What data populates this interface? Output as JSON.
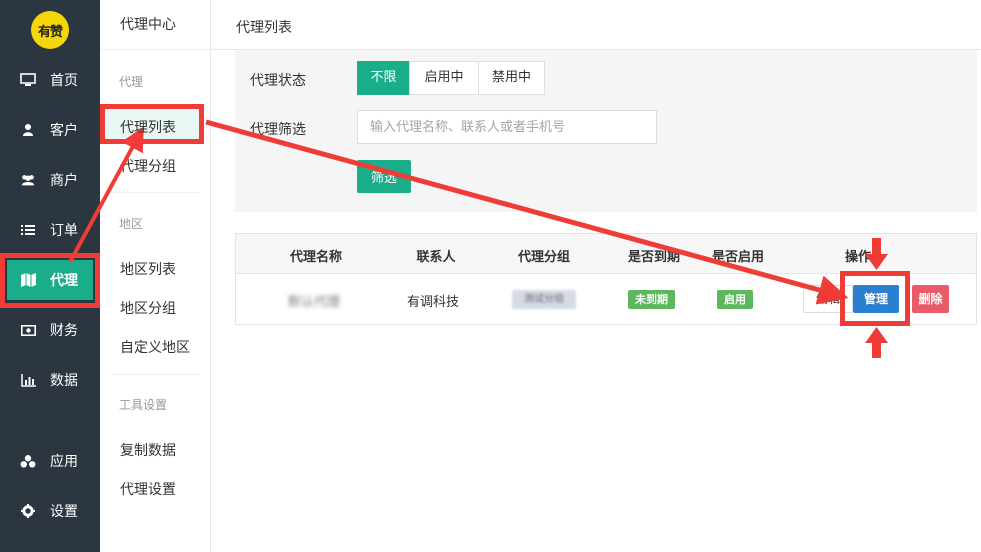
{
  "logo": {
    "text": "有赞"
  },
  "nav": {
    "items": [
      {
        "label": "首页",
        "icon": "monitor-icon"
      },
      {
        "label": "客户",
        "icon": "user-icon"
      },
      {
        "label": "商户",
        "icon": "users-icon"
      },
      {
        "label": "订单",
        "icon": "list-icon"
      },
      {
        "label": "代理",
        "icon": "map-icon",
        "active": true
      },
      {
        "label": "财务",
        "icon": "money-icon"
      },
      {
        "label": "数据",
        "icon": "bar-chart-icon"
      },
      {
        "label": "应用",
        "icon": "apps-icon"
      },
      {
        "label": "设置",
        "icon": "gear-icon"
      }
    ]
  },
  "submenu": {
    "title": "代理中心",
    "group1": "代理",
    "item_list": "代理列表",
    "item_group": "代理分组",
    "group2": "地区",
    "item_region_list": "地区列表",
    "item_region_group": "地区分组",
    "item_custom_region": "自定义地区",
    "group3": "工具设置",
    "item_copy_data": "复制数据",
    "item_agent_settings": "代理设置"
  },
  "header": {
    "title": "代理列表"
  },
  "filters": {
    "status_label": "代理状态",
    "status_options": [
      "不限",
      "启用中",
      "禁用中"
    ],
    "status_selected": "不限",
    "search_label": "代理筛选",
    "search_placeholder": "输入代理名称、联系人或者手机号",
    "filter_button": "筛选"
  },
  "table": {
    "headers": [
      "代理名称",
      "联系人",
      "代理分组",
      "是否到期",
      "是否启用",
      "操作"
    ],
    "rows": [
      {
        "name": "默认代理",
        "contact": "有调科技",
        "group": "测试分组",
        "expired": "未到期",
        "enabled": "启用",
        "actions": [
          "编辑",
          "管理",
          "删除"
        ]
      }
    ]
  },
  "colors": {
    "nav_bg": "#2b3640",
    "accent": "#1aad89",
    "annotation_red": "#f03c37",
    "manage_blue": "#2a7fd0",
    "delete_red": "#e95b69",
    "badge_green": "#5cb85c"
  }
}
